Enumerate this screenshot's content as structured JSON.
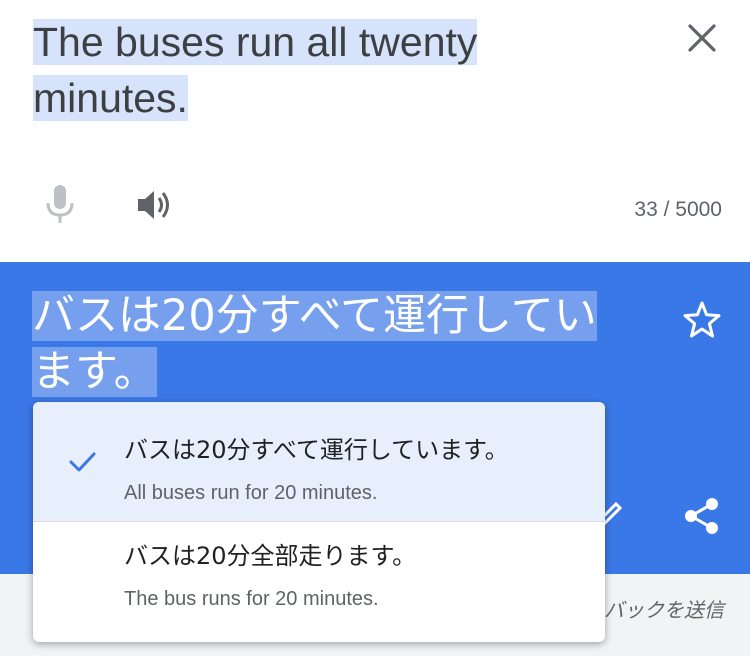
{
  "source": {
    "text": "The buses run all twenty minutes.",
    "lines": [
      "The buses run all twenty",
      "minutes."
    ],
    "char_count": "33 / 5000",
    "icons": {
      "close": "close-icon",
      "mic": "mic-icon",
      "speaker": "speaker-icon"
    }
  },
  "translation": {
    "lines": [
      "バスは20分すべて運行してい",
      "ます。"
    ],
    "icons": {
      "star": "star-icon",
      "edit": "edit-icon",
      "share": "share-icon"
    }
  },
  "alternatives": [
    {
      "text": "バスは20分すべて運行しています。",
      "back_translation": "All buses run for 20 minutes.",
      "selected": true
    },
    {
      "text": "バスは20分全部走ります。",
      "back_translation": "The bus runs for 20 minutes.",
      "selected": false
    }
  ],
  "feedback_label": "バックを送信",
  "colors": {
    "accent": "#3b78e7",
    "highlight": "#d7e3fb",
    "check": "#3b78e7"
  }
}
